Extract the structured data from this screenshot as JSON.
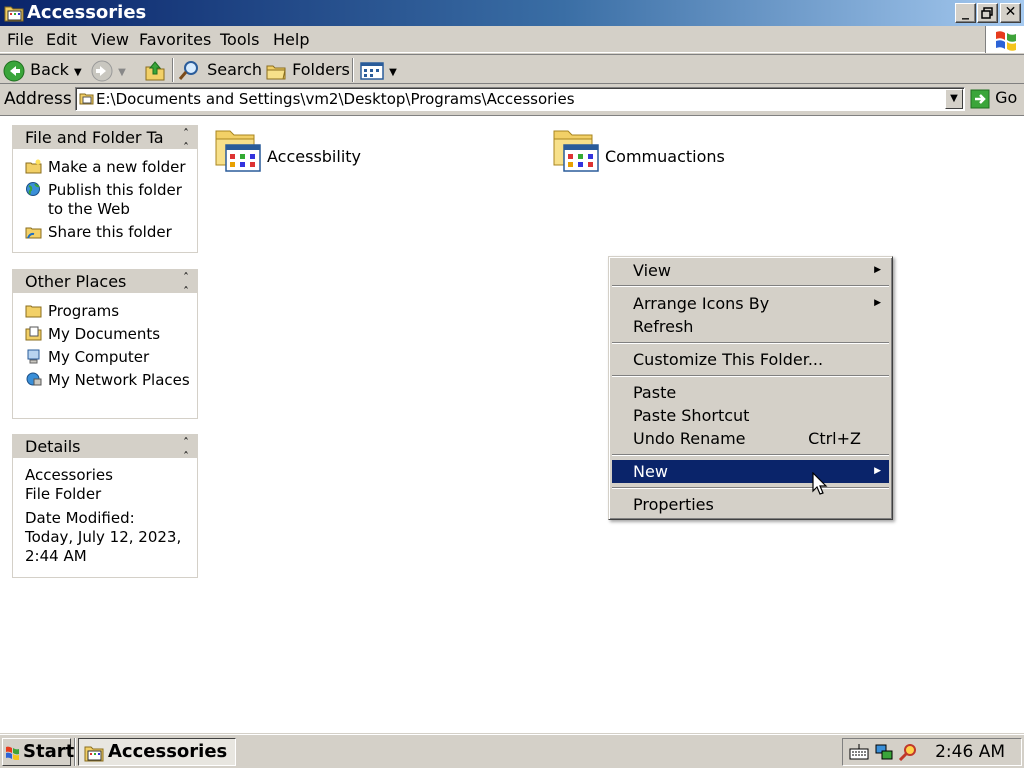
{
  "window": {
    "title": "Accessories",
    "controls": [
      "minimize",
      "restore",
      "close"
    ]
  },
  "menubar": {
    "items": [
      "File",
      "Edit",
      "View",
      "Favorites",
      "Tools",
      "Help"
    ]
  },
  "toolbar": {
    "back_label": "Back",
    "search_label": "Search",
    "folders_label": "Folders"
  },
  "address": {
    "label": "Address",
    "value": "E:\\Documents and Settings\\vm2\\Desktop\\Programs\\Accessories",
    "go_label": "Go"
  },
  "tasks_panel": {
    "title": "File and Folder Ta",
    "links": [
      "Make a new folder",
      "Publish this folder to the Web",
      "Share this folder"
    ]
  },
  "places_panel": {
    "title": "Other Places",
    "links": [
      "Programs",
      "My Documents",
      "My Computer",
      "My Network Places"
    ]
  },
  "details_panel": {
    "title": "Details",
    "name": "Accessories",
    "type": "File Folder",
    "modified_label": "Date Modified:",
    "modified_value": "Today, July 12, 2023, 2:44 AM"
  },
  "folders": [
    {
      "name": "Accessbility"
    },
    {
      "name": "Commuactions"
    }
  ],
  "context_menu": {
    "items": [
      {
        "label": "View",
        "submenu": true
      },
      {
        "label": "Arrange Icons By",
        "submenu": true
      },
      {
        "label": "Refresh"
      },
      {
        "label": "Customize This Folder..."
      },
      {
        "label": "Paste"
      },
      {
        "label": "Paste Shortcut"
      },
      {
        "label": "Undo Rename",
        "shortcut": "Ctrl+Z"
      },
      {
        "label": "New",
        "submenu": true,
        "highlighted": true
      },
      {
        "label": "Properties"
      }
    ]
  },
  "taskbar": {
    "start_label": "Start",
    "task_label": "Accessories",
    "clock": "2:46 AM"
  },
  "colors": {
    "highlight": "#0a246a",
    "face": "#d4d0c8"
  }
}
